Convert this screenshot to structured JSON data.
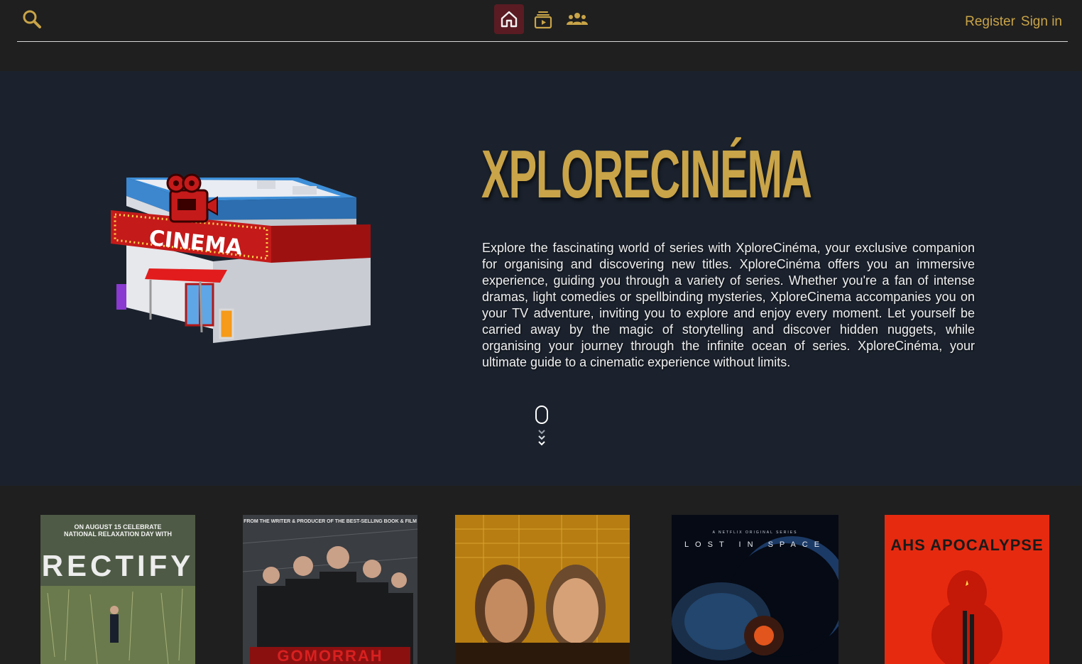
{
  "header": {
    "search_icon": "search-icon",
    "nav": [
      {
        "name": "home",
        "icon": "home-icon",
        "active": true
      },
      {
        "name": "series",
        "icon": "tv-stack-play-icon",
        "active": false
      },
      {
        "name": "community",
        "icon": "people-group-icon",
        "active": false
      }
    ],
    "register_label": "Register",
    "signin_label": "Sign in"
  },
  "hero": {
    "title": "XPLORECINÉMA",
    "sign_text": "CINEMA",
    "description": "Explore the fascinating world of series with XploreCinéma, your exclusive companion for organising and discovering new titles. XploreCinéma offers you an immersive experience, guiding you through a variety of series. Whether you're a fan of intense dramas, light comedies or spellbinding mysteries, XploreCinema accompanies you on your TV adventure, inviting you to explore and enjoy every moment. Let yourself be carried away by the magic of storytelling and discover hidden nuggets, while organising your journey through the infinite ocean of series. XploreCinéma, your ultimate guide to a cinematic experience without limits.",
    "scroll_icon": "scroll-down-mouse-icon"
  },
  "posters": [
    {
      "title": "RECTIFY",
      "tagline": "ON AUGUST 15 CELEBRATE NATIONAL RELAXATION DAY WITH"
    },
    {
      "title": "GOMORRAH",
      "tagline": "FROM THE WRITER & PRODUCER OF THE BEST-SELLING BOOK & FILM"
    },
    {
      "title": "",
      "tagline": ""
    },
    {
      "title": "LOST IN SPACE",
      "tagline": "A NETFLIX ORIGINAL SERIES"
    },
    {
      "title": "AHS APOCALYPSE",
      "tagline": ""
    }
  ],
  "colors": {
    "accent": "#c9a448",
    "hero_bg": "#1b222d",
    "page_bg": "#1f1f1f",
    "active_nav": "#5a1b23"
  }
}
